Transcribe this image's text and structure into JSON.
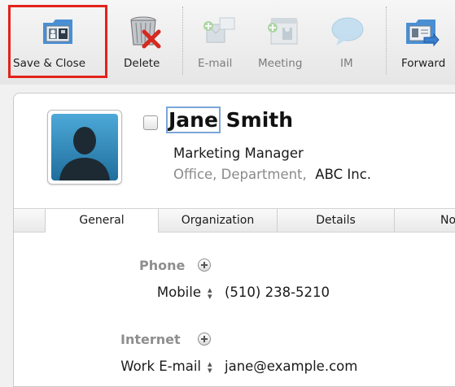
{
  "toolbar": {
    "buttons": [
      {
        "label": "Save & Close",
        "icon": "save-close-icon",
        "enabled": true,
        "highlighted": true
      },
      {
        "label": "Delete",
        "icon": "delete-trash-icon",
        "enabled": true
      },
      {
        "label": "E-mail",
        "icon": "email-icon",
        "enabled": false
      },
      {
        "label": "Meeting",
        "icon": "meeting-calendar-icon",
        "enabled": false
      },
      {
        "label": "IM",
        "icon": "chat-bubble-icon",
        "enabled": false
      },
      {
        "label": "Forward",
        "icon": "forward-icon",
        "enabled": true
      }
    ]
  },
  "contact": {
    "first_name": "Jane",
    "last_name": "Smith",
    "job_title": "Marketing Manager",
    "office": "Office",
    "department": "Department",
    "company": "ABC Inc."
  },
  "tabs": [
    {
      "label": "General",
      "active": true
    },
    {
      "label": "Organization"
    },
    {
      "label": "Details"
    },
    {
      "label": "Not"
    }
  ],
  "general": {
    "phone": {
      "section_label": "Phone",
      "field_label": "Mobile",
      "value": "(510) 238-5210"
    },
    "internet": {
      "section_label": "Internet",
      "field_label": "Work E-mail",
      "value": "jane@example.com"
    }
  },
  "colors": {
    "highlight_border": "#e2231a",
    "avatar_blue": "#2a86bd",
    "muted_text": "#8a8a8a",
    "name_focus_ring": "#7aa6d8"
  }
}
